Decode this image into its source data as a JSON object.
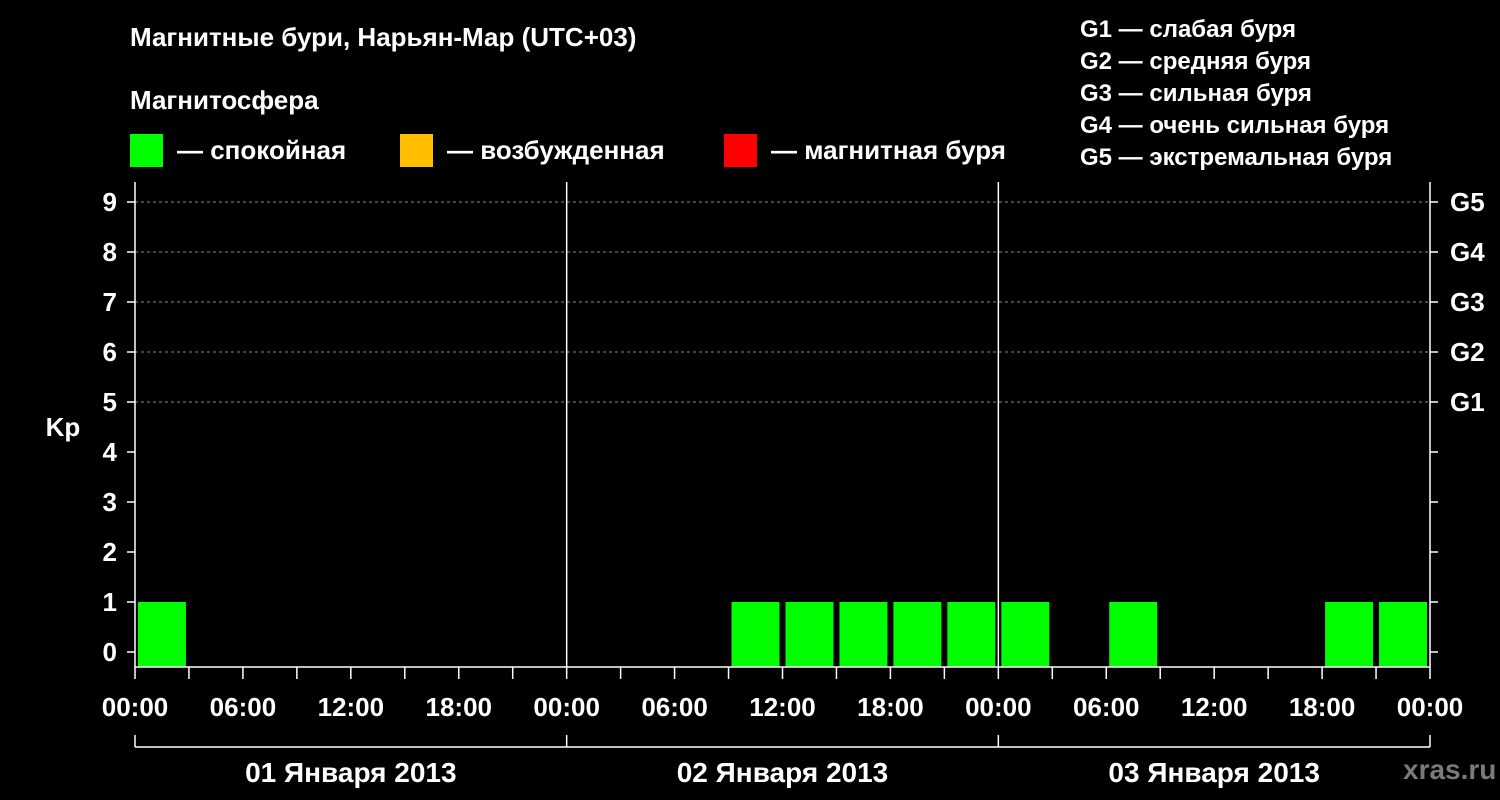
{
  "header": {
    "title": "Магнитные бури, Нарьян-Мар (UTC+03)",
    "subtitle": "Магнитосфера"
  },
  "legend": {
    "items": [
      {
        "label": "— спокойная",
        "color": "#00ff00"
      },
      {
        "label": "— возбужденная",
        "color": "#ffbf00"
      },
      {
        "label": "— магнитная буря",
        "color": "#ff0000"
      }
    ]
  },
  "storm_scale": [
    "G1 — слабая буря",
    "G2 — средняя буря",
    "G3 — сильная буря",
    "G4 — очень сильная буря",
    "G5 — экстремальная буря"
  ],
  "watermark": "xras.ru",
  "chart_data": {
    "type": "bar",
    "ylabel": "Kp",
    "ylim": [
      0,
      9
    ],
    "y_ticks": [
      0,
      1,
      2,
      3,
      4,
      5,
      6,
      7,
      8,
      9
    ],
    "right_ticks": [
      {
        "y": 5,
        "label": "G1"
      },
      {
        "y": 6,
        "label": "G2"
      },
      {
        "y": 7,
        "label": "G3"
      },
      {
        "y": 8,
        "label": "G4"
      },
      {
        "y": 9,
        "label": "G5"
      }
    ],
    "x_tick_labels": [
      "00:00",
      "06:00",
      "12:00",
      "18:00",
      "00:00",
      "06:00",
      "12:00",
      "18:00",
      "00:00",
      "06:00",
      "12:00",
      "18:00",
      "00:00"
    ],
    "days": [
      "01 Января 2013",
      "02 Января 2013",
      "03 Января 2013"
    ],
    "interval_hours": 3,
    "values": [
      1,
      0,
      0,
      0,
      0,
      0,
      0,
      0,
      0,
      0,
      0,
      1,
      1,
      1,
      1,
      1,
      1,
      0,
      1,
      0,
      0,
      0,
      1,
      1
    ],
    "bar_color": "#00ff00",
    "grid_dashed_at": [
      5,
      6,
      7,
      8,
      9
    ]
  }
}
